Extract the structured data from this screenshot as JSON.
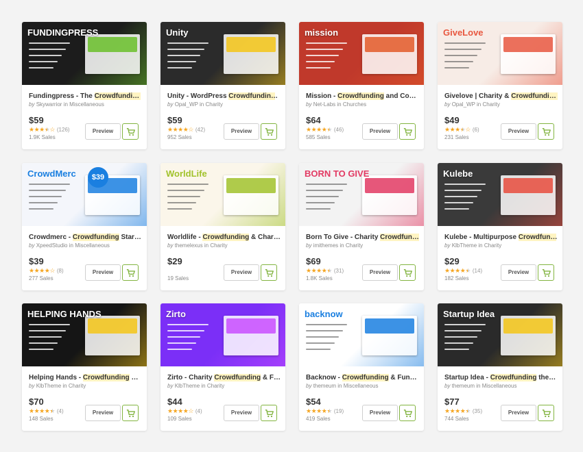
{
  "colors": {
    "accent": "#82b440",
    "star": "#f5a623",
    "highlight": "#fff4c2"
  },
  "icons": {
    "cart": "cart-icon",
    "star": "star-icon"
  },
  "labels": {
    "preview": "Preview"
  },
  "cards": [
    {
      "title_pre": "Fundingpress - The ",
      "title_hl": "Crowdfunding",
      "title_post": " ...",
      "by": "by",
      "author": "Skywarrior",
      "in": "in",
      "category": "Miscellaneous",
      "price": "$59",
      "stars": 3.5,
      "reviews": "(126)",
      "sales": "1.9K Sales",
      "thumb_text": "FUNDINGPRESS",
      "thumb_bg": "#1c1c1c",
      "thumb_accent": "#6abf2a"
    },
    {
      "title_pre": "Unity - WordPress ",
      "title_hl": "Crowdfunding",
      "title_post": " T...",
      "by": "by",
      "author": "Opal_WP",
      "in": "in",
      "category": "Charity",
      "price": "$59",
      "stars": 4,
      "reviews": "(42)",
      "sales": "952 Sales",
      "thumb_text": "Unity",
      "thumb_bg": "#2b2b2b",
      "thumb_accent": "#f5c518"
    },
    {
      "title_pre": "Mission - ",
      "title_hl": "Crowdfunding",
      "title_post": " and Comm...",
      "by": "by",
      "author": "Net-Labs",
      "in": "in",
      "category": "Churches",
      "price": "$64",
      "stars": 4.5,
      "reviews": "(46)",
      "sales": "585 Sales",
      "thumb_text": "mission",
      "thumb_bg": "#c0392b",
      "thumb_accent": "#e35b2a"
    },
    {
      "title_pre": "Givelove | Charity & ",
      "title_hl": "Crowdfunding",
      "title_post": " ...",
      "by": "by",
      "author": "Opal_WP",
      "in": "in",
      "category": "Charity",
      "price": "$49",
      "stars": 3.5,
      "reviews": "(6)",
      "sales": "231 Sales",
      "thumb_text": "GiveLove",
      "thumb_bg": "#f7ece6",
      "thumb_accent": "#e8573f"
    },
    {
      "title_pre": "Crowdmerc - ",
      "title_hl": "Crowdfunding",
      "title_post": " Startu...",
      "by": "by",
      "author": "XpeedStudio",
      "in": "in",
      "category": "Miscellaneous",
      "price": "$39",
      "stars": 4,
      "reviews": "(8)",
      "sales": "277 Sales",
      "thumb_text": "CrowdMerc",
      "thumb_bg": "#f4f6fb",
      "thumb_accent": "#1a7fe0",
      "badge": "$39"
    },
    {
      "title_pre": "Worldlife - ",
      "title_hl": "Crowdfunding",
      "title_post": " & Charity...",
      "by": "by",
      "author": "themelexus",
      "in": "in",
      "category": "Charity",
      "price": "$29",
      "stars": 0,
      "reviews": "",
      "sales": "19 Sales",
      "thumb_text": "WorldLife",
      "thumb_bg": "#fbf6ea",
      "thumb_accent": "#a1c22b"
    },
    {
      "title_pre": "Born To Give - Charity ",
      "title_hl": "Crowdfunding",
      "title_post": "...",
      "by": "by",
      "author": "imithemes",
      "in": "in",
      "category": "Charity",
      "price": "$69",
      "stars": 4.5,
      "reviews": "(31)",
      "sales": "1.8K Sales",
      "thumb_text": "BORN TO GIVE",
      "thumb_bg": "#f3f3f3",
      "thumb_accent": "#e23a63"
    },
    {
      "title_pre": "Kulebe - Multipurpose ",
      "title_hl": "Crowdfundi",
      "title_post": "...",
      "by": "by",
      "author": "KlbTheme",
      "in": "in",
      "category": "Charity",
      "price": "$29",
      "stars": 4.5,
      "reviews": "(14)",
      "sales": "182 Sales",
      "thumb_text": "Kulebe",
      "thumb_bg": "#3a3a3a",
      "thumb_accent": "#e84c3d"
    },
    {
      "title_pre": "Helping Hands - ",
      "title_hl": "Crowdfunding",
      "title_post": " Ch...",
      "by": "by",
      "author": "KlbTheme",
      "in": "in",
      "category": "Charity",
      "price": "$70",
      "stars": 4.5,
      "reviews": "(4)",
      "sales": "148 Sales",
      "thumb_text": "HELPING HANDS",
      "thumb_bg": "#151515",
      "thumb_accent": "#f5c518"
    },
    {
      "title_pre": "Zirto - Charity ",
      "title_hl": "Crowdfunding",
      "title_post": " & Fun...",
      "by": "by",
      "author": "KlbTheme",
      "in": "in",
      "category": "Charity",
      "price": "$44",
      "stars": 4,
      "reviews": "(4)",
      "sales": "109 Sales",
      "thumb_text": "Zirto",
      "thumb_bg": "#7b2ff7",
      "thumb_accent": "#c94dff"
    },
    {
      "title_pre": "Backnow - ",
      "title_hl": "Crowdfunding",
      "title_post": " & Fundra...",
      "by": "by",
      "author": "themeum",
      "in": "in",
      "category": "Miscellaneous",
      "price": "$54",
      "stars": 4.5,
      "reviews": "(19)",
      "sales": "419 Sales",
      "thumb_text": "backnow",
      "thumb_bg": "#ffffff",
      "thumb_accent": "#1a7fe0"
    },
    {
      "title_pre": "Startup Idea - ",
      "title_hl": "Crowdfunding",
      "title_post": " them...",
      "by": "by",
      "author": "themeum",
      "in": "in",
      "category": "Miscellaneous",
      "price": "$77",
      "stars": 4.5,
      "reviews": "(35)",
      "sales": "744 Sales",
      "thumb_text": "Startup Idea",
      "thumb_bg": "#2a2a2a",
      "thumb_accent": "#f5c518"
    }
  ]
}
